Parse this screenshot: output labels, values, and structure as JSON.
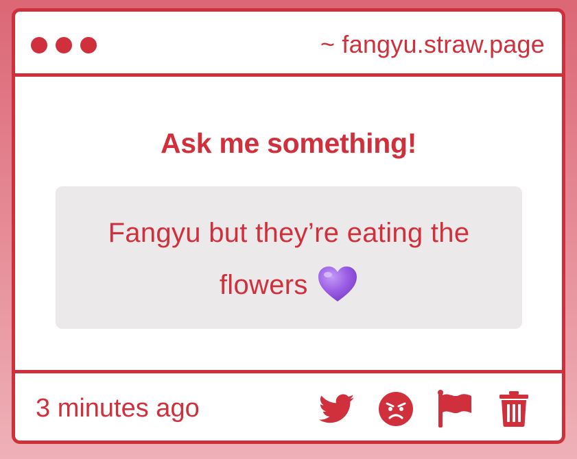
{
  "window": {
    "site_label": "~ fangyu.straw.page"
  },
  "prompt": {
    "heading": "Ask me something!"
  },
  "question": {
    "text": "Fangyu but they’re eating the flowers",
    "emoji": "purple-heart"
  },
  "footer": {
    "time_ago": "3 minutes ago",
    "actions": [
      "twitter-icon",
      "angry-face-icon",
      "flag-icon",
      "trash-icon"
    ]
  },
  "colors": {
    "accent": "#d0303c",
    "card_background": "#ffffff",
    "question_background": "#ebe9ea",
    "page_background_top": "#dc6775",
    "page_background_bottom": "#efb1b8",
    "heart": "#9b5de5"
  }
}
